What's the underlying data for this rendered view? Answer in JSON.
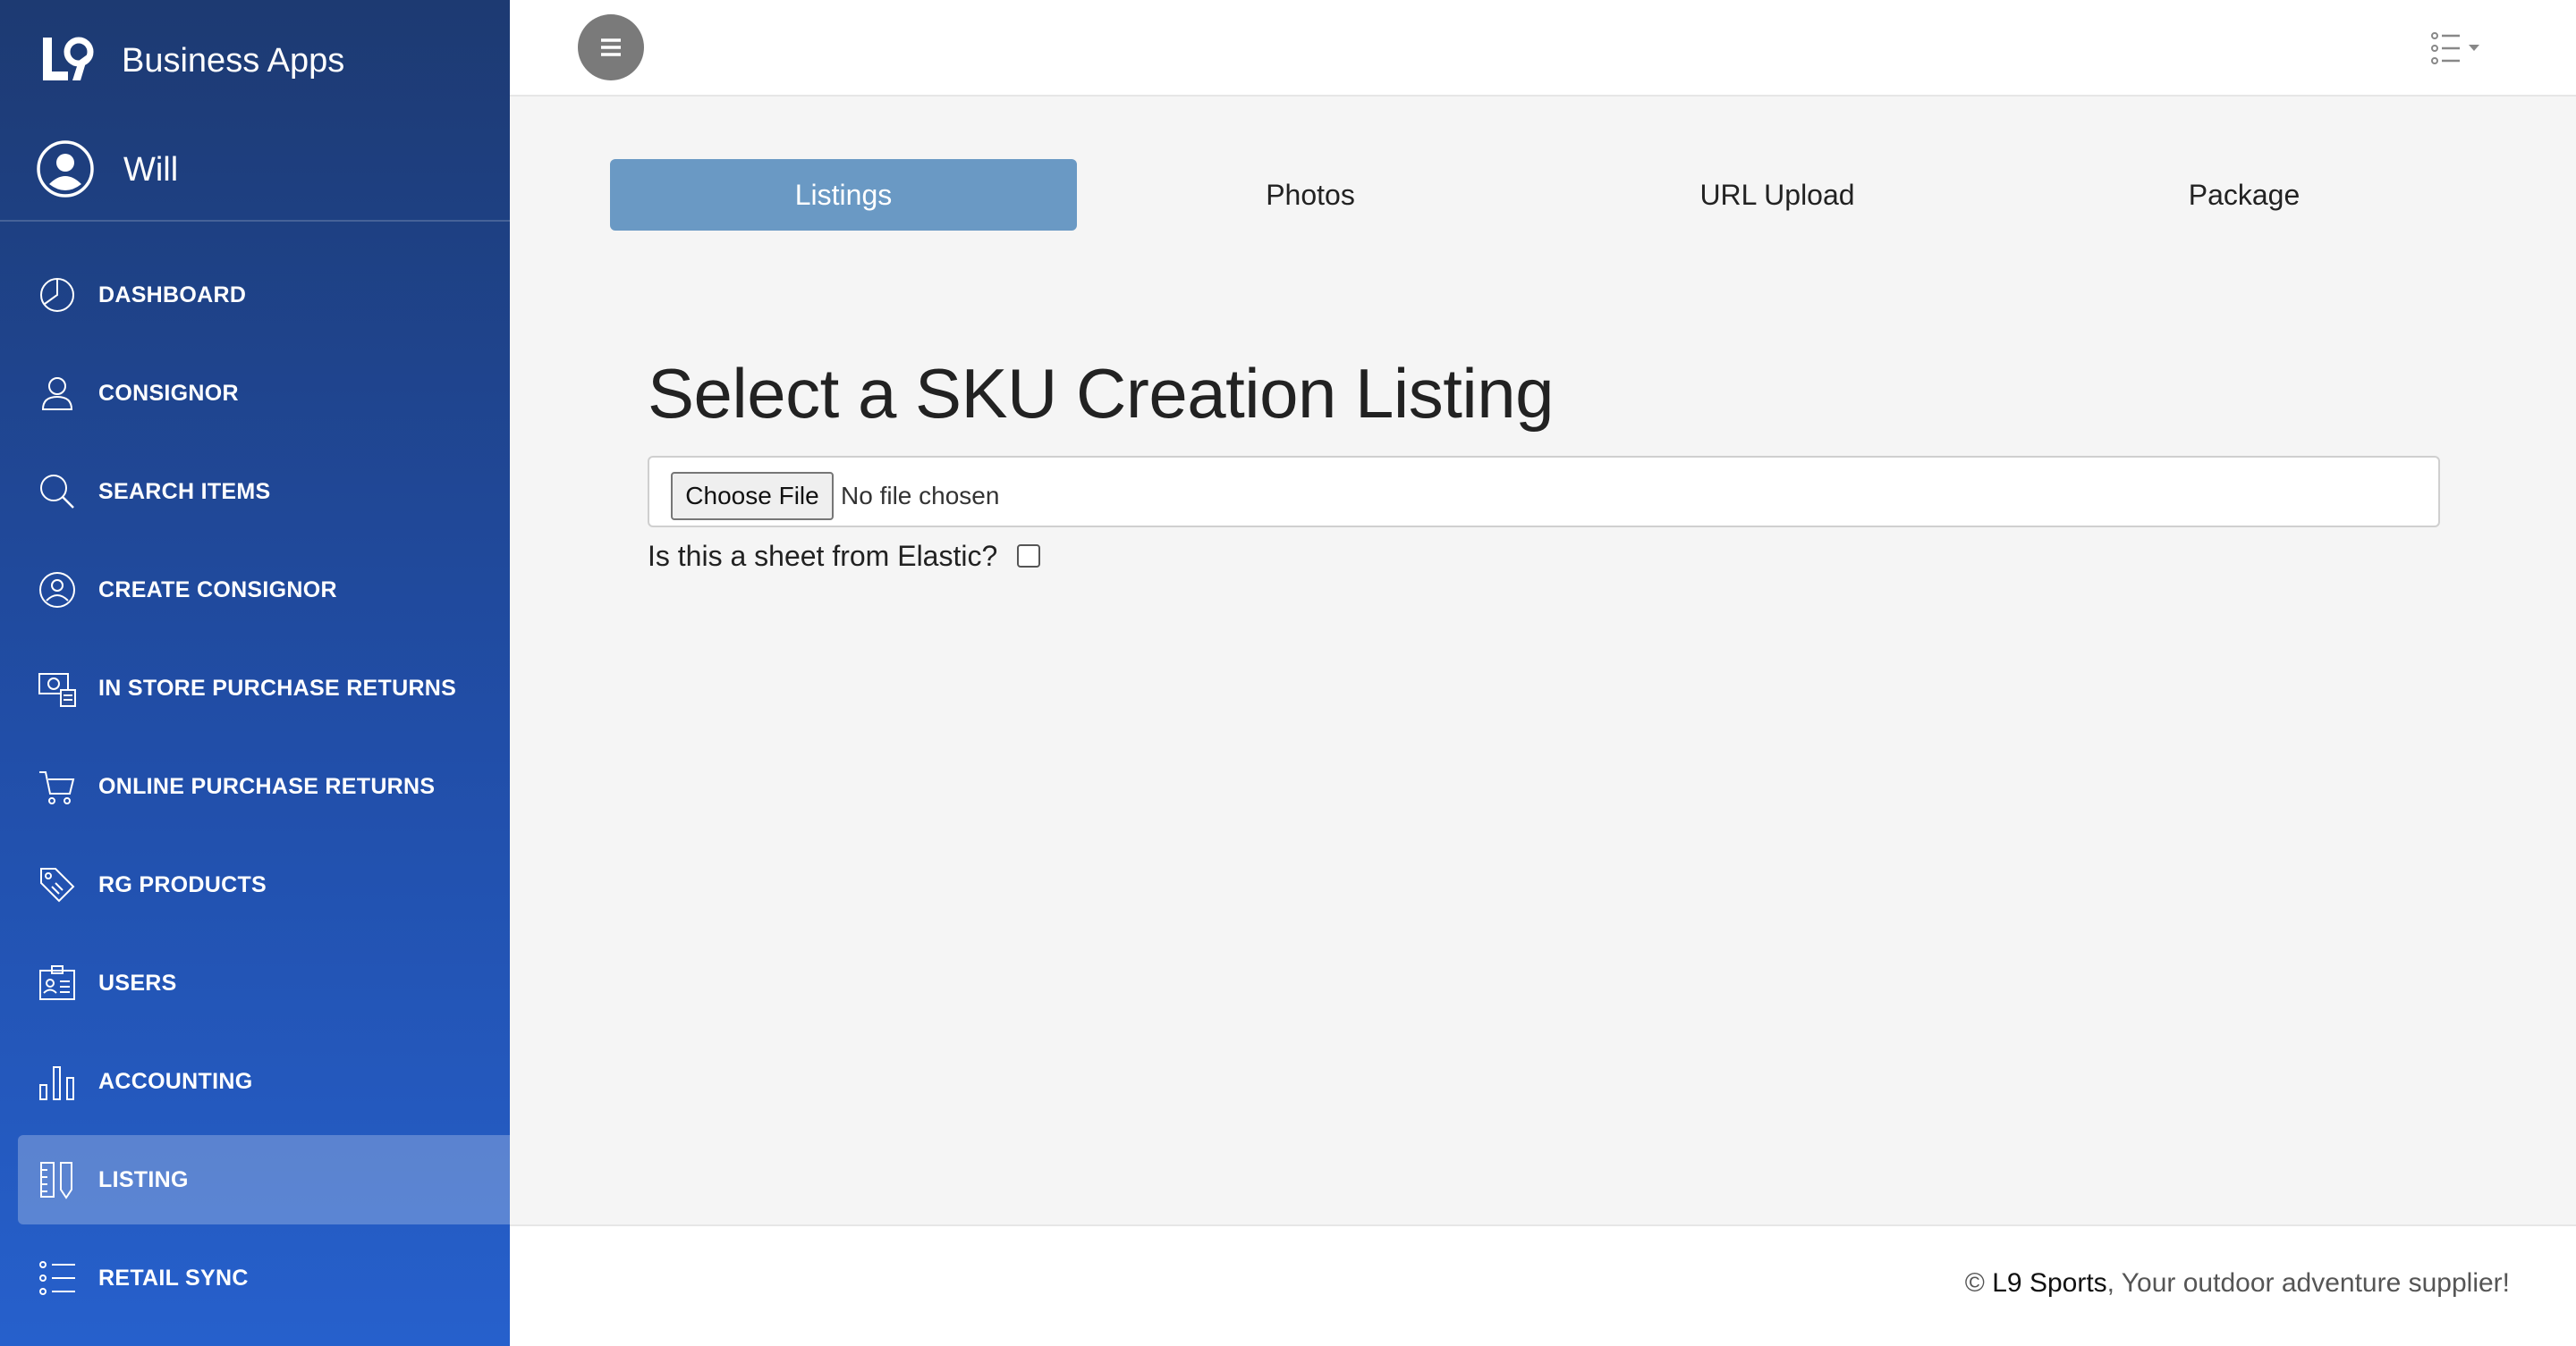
{
  "brand": {
    "title": "Business Apps",
    "logo_icon": "l9-logo-icon"
  },
  "user": {
    "name": "Will",
    "avatar_icon": "user-circle-icon"
  },
  "sidebar": {
    "items": [
      {
        "label": "DASHBOARD",
        "icon": "pie-chart-icon",
        "active": false
      },
      {
        "label": "CONSIGNOR",
        "icon": "person-icon",
        "active": false
      },
      {
        "label": "SEARCH ITEMS",
        "icon": "search-icon",
        "active": false
      },
      {
        "label": "CREATE CONSIGNOR",
        "icon": "user-circle-icon",
        "active": false
      },
      {
        "label": "IN STORE PURCHASE RETURNS",
        "icon": "cash-return-icon",
        "active": false
      },
      {
        "label": "ONLINE PURCHASE RETURNS",
        "icon": "cart-icon",
        "active": false
      },
      {
        "label": "RG PRODUCTS",
        "icon": "tags-icon",
        "active": false
      },
      {
        "label": "USERS",
        "icon": "id-badge-icon",
        "active": false
      },
      {
        "label": "ACCOUNTING",
        "icon": "bar-chart-icon",
        "active": false
      },
      {
        "label": "LISTING",
        "icon": "ruler-pencil-icon",
        "active": true
      },
      {
        "label": "RETAIL SYNC",
        "icon": "list-icon",
        "active": false
      }
    ]
  },
  "topbar": {
    "menu_icon": "hamburger-icon",
    "view_icon": "list-view-icon"
  },
  "tabs": [
    {
      "label": "Listings",
      "active": true
    },
    {
      "label": "Photos",
      "active": false
    },
    {
      "label": "URL Upload",
      "active": false
    },
    {
      "label": "Package",
      "active": false
    }
  ],
  "main": {
    "heading": "Select a SKU Creation Listing",
    "file_button": "Choose File",
    "file_status": "No file chosen",
    "elastic_question": "Is this a sheet from Elastic?",
    "elastic_checked": false
  },
  "footer": {
    "copyright": "©",
    "brand": "L9 Sports",
    "tagline": ", Your outdoor adventure supplier!"
  },
  "colors": {
    "sidebar_top": "#1d3a72",
    "sidebar_bottom": "#2660cc",
    "active_tab": "#6a99c4"
  }
}
